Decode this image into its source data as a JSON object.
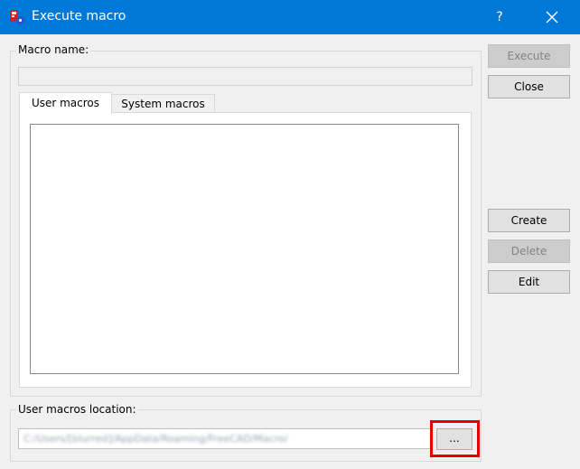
{
  "window": {
    "title": "Execute macro",
    "help_label": "?",
    "app_icon": "freecad-macro-icon",
    "close_icon": "close-icon"
  },
  "macro_name": {
    "label": "Macro name:",
    "value": ""
  },
  "tabs": [
    {
      "label": "User macros",
      "active": true
    },
    {
      "label": "System macros",
      "active": false
    }
  ],
  "macro_list": [],
  "buttons": {
    "execute": "Execute",
    "close": "Close",
    "create": "Create",
    "delete": "Delete",
    "edit": "Edit"
  },
  "location": {
    "label": "User macros location:",
    "path": "C:/Users/[blurred]/AppData/Roaming/FreeCAD/Macro/",
    "browse_label": "..."
  },
  "colors": {
    "titlebar": "#0078d7",
    "highlight": "#e00000",
    "background": "#f0f0f0"
  }
}
